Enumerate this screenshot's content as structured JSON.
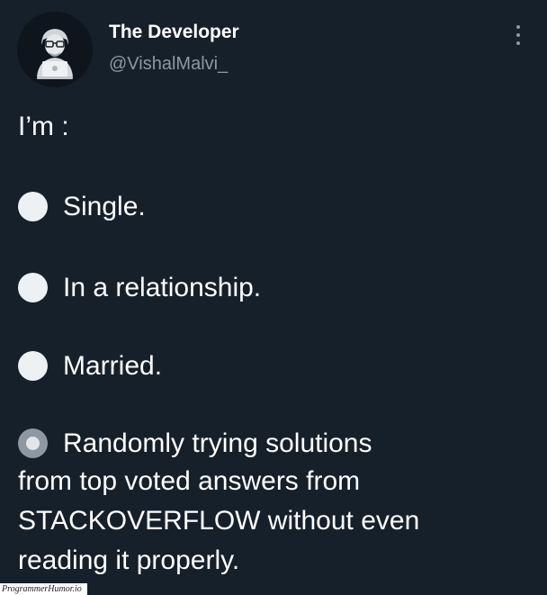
{
  "author": {
    "name": "The Developer",
    "handle": "@VishalMalvi_",
    "avatar_icon": "developer-at-laptop-avatar",
    "menu_icon": "more-vertical-icon"
  },
  "tweet": {
    "intro": "I’m :",
    "options": [
      {
        "label": "Single.",
        "selected": false
      },
      {
        "label": "In a relationship.",
        "selected": false
      },
      {
        "label": "Married.",
        "selected": false
      },
      {
        "label": "Randomly trying solutions",
        "selected": true,
        "continuation": [
          "from top voted answers from",
          "STACKOVERFLOW  without even",
          "reading it  properly."
        ]
      }
    ]
  },
  "watermark": "ProgrammerHumor.io",
  "colors": {
    "background": "#15202b",
    "text": "#ffffff",
    "secondary_text": "#8b98a5",
    "circle": "#eef1f4",
    "circle_selected": "#8e98a3"
  }
}
